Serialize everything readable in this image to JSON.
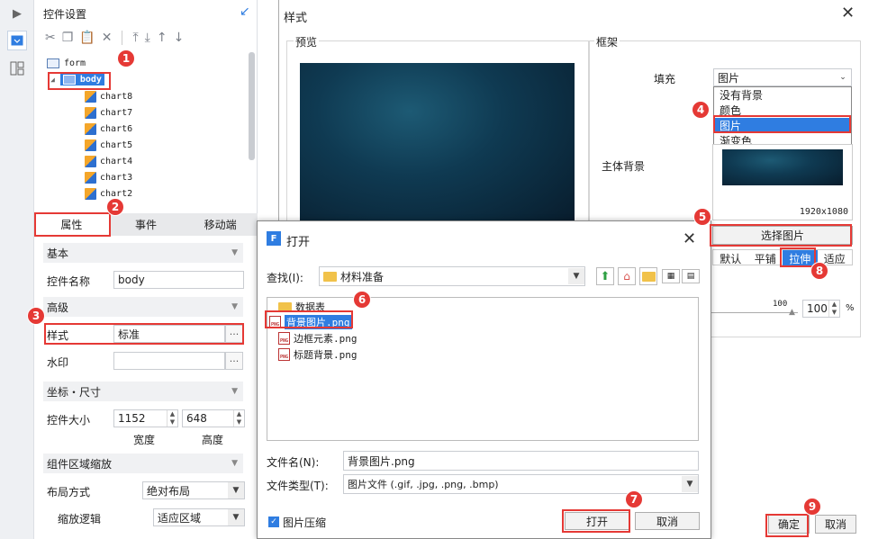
{
  "rail": {
    "expand_icon": "chevron-right-icon",
    "items": [
      "widget-settings-icon",
      "layout-icon"
    ]
  },
  "panel": {
    "title": "控件设置",
    "tree": [
      {
        "label": "form",
        "level": 0
      },
      {
        "label": "body",
        "level": 0,
        "selected": true
      },
      {
        "label": "chart8",
        "level": 1
      },
      {
        "label": "chart7",
        "level": 1
      },
      {
        "label": "chart6",
        "level": 1
      },
      {
        "label": "chart5",
        "level": 1
      },
      {
        "label": "chart4",
        "level": 1
      },
      {
        "label": "chart3",
        "level": 1
      },
      {
        "label": "chart2",
        "level": 1
      }
    ],
    "tabs": [
      "属性",
      "事件",
      "移动端"
    ],
    "sections": {
      "basic": "基本",
      "widget_name_label": "控件名称",
      "widget_name_value": "body",
      "advanced": "高级",
      "style_label": "样式",
      "style_value": "标准",
      "watermark_label": "水印",
      "coord_size": "坐标・尺寸",
      "widget_size_label": "控件大小",
      "width_value": "1152",
      "height_value": "648",
      "width_caption": "宽度",
      "height_caption": "高度",
      "zoom_section": "组件区域缩放",
      "layout_label": "布局方式",
      "layout_value": "绝对布局",
      "zoom_logic_label": "缩放逻辑",
      "zoom_logic_value": "适应区域"
    }
  },
  "style_dialog": {
    "title": "样式",
    "preview_label": "预览",
    "frame_label": "框架",
    "fill_label": "填充",
    "fill_value": "图片",
    "fill_options": [
      "没有背景",
      "颜色",
      "图片",
      "渐变色"
    ],
    "main_bg_label": "主体背景",
    "image_size": "1920x1080",
    "choose_image_button": "选择图片",
    "modes": [
      "默认",
      "平铺",
      "拉伸",
      "适应"
    ],
    "active_mode": "拉伸",
    "opacity_tick": "100",
    "opacity_value": "100",
    "opacity_unit": "%",
    "ok_button": "确定",
    "cancel_button": "取消"
  },
  "open_dialog": {
    "title": "打开",
    "look_in_label": "查找(I):",
    "look_in_value": "材料准备",
    "files": [
      {
        "name": "数据表",
        "type": "folder"
      },
      {
        "name": "背景图片.png",
        "type": "png",
        "selected": true
      },
      {
        "name": "边框元素.png",
        "type": "png"
      },
      {
        "name": "标题背景.png",
        "type": "png"
      }
    ],
    "filename_label": "文件名(N):",
    "filename_value": "背景图片.png",
    "filetype_label": "文件类型(T):",
    "filetype_value": "图片文件 (.gif, .jpg, .png, .bmp)",
    "compress_label": "图片压缩",
    "open_button": "打开",
    "cancel_button": "取消"
  },
  "callouts": [
    "1",
    "2",
    "3",
    "4",
    "5",
    "6",
    "7",
    "8",
    "9"
  ],
  "colors": {
    "accent": "#2f7de1",
    "callout": "#e53935"
  }
}
